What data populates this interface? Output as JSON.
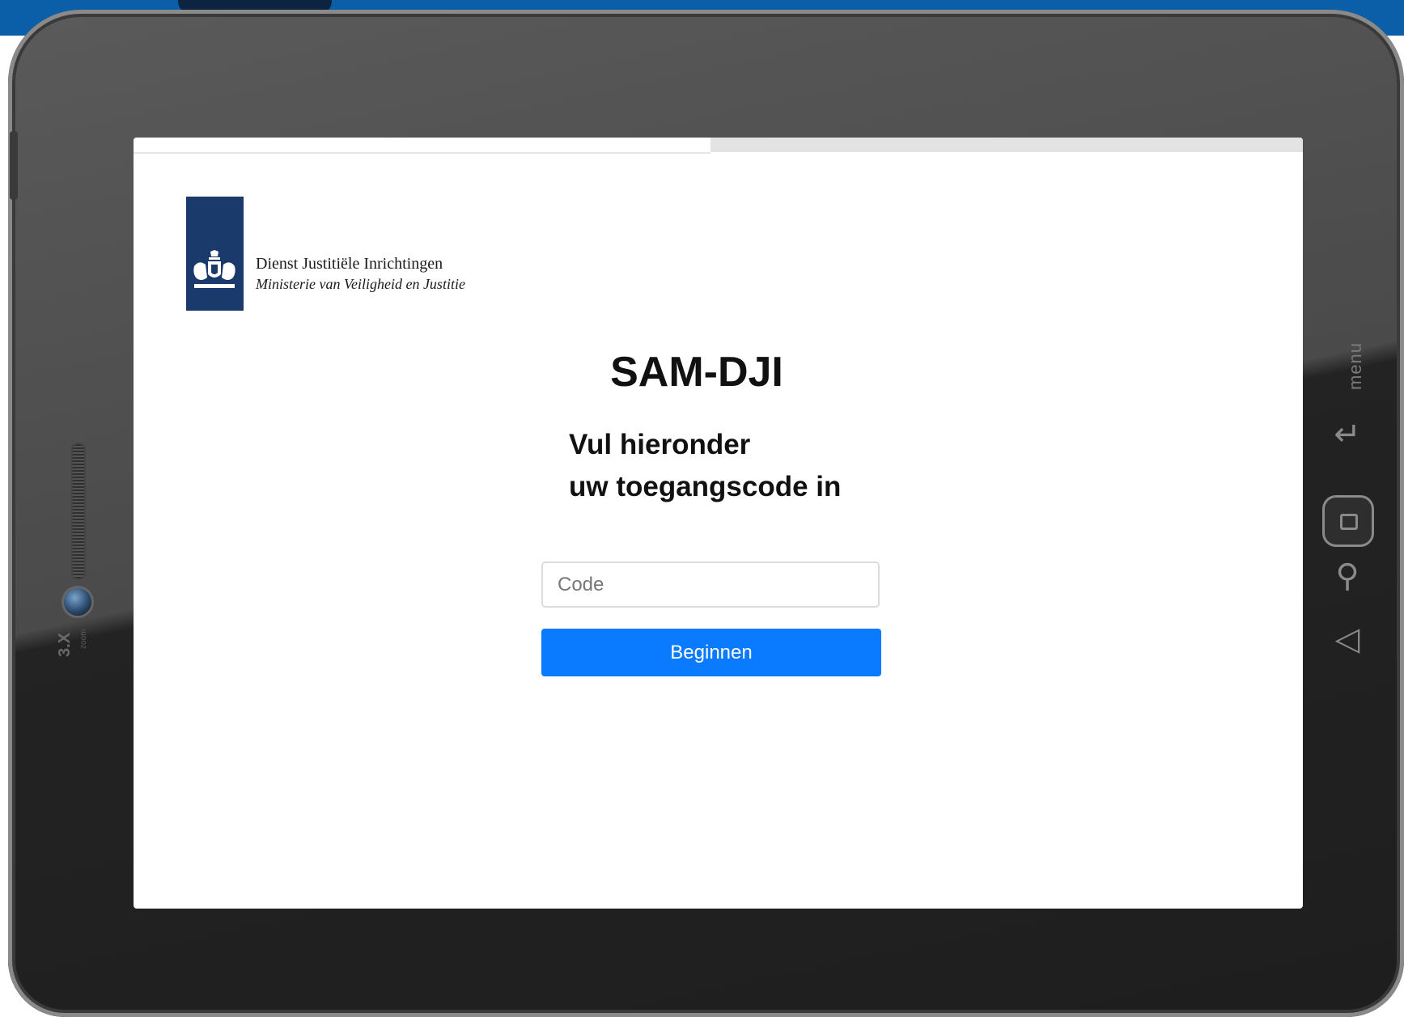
{
  "org": {
    "name": "Dienst Justitiële Inrichtingen",
    "ministry": "Ministerie van Veiligheid en Justitie"
  },
  "app": {
    "title": "SAM-DJI",
    "instruction_line1": "Vul hieronder",
    "instruction_line2": "uw toegangscode in"
  },
  "form": {
    "code_placeholder": "Code",
    "code_value": "",
    "submit_label": "Beginnen"
  },
  "device": {
    "zoom_label": "3.X",
    "zoom_sub": "zoom",
    "menu_label": "menu"
  },
  "icons": [
    "crest-icon",
    "rotate-icon",
    "home-icon",
    "search-icon",
    "back-icon"
  ],
  "colors": {
    "primary_button": "#0a7bff",
    "logo_blue": "#1a3a6b",
    "top_bar": "#0a5fa8"
  }
}
